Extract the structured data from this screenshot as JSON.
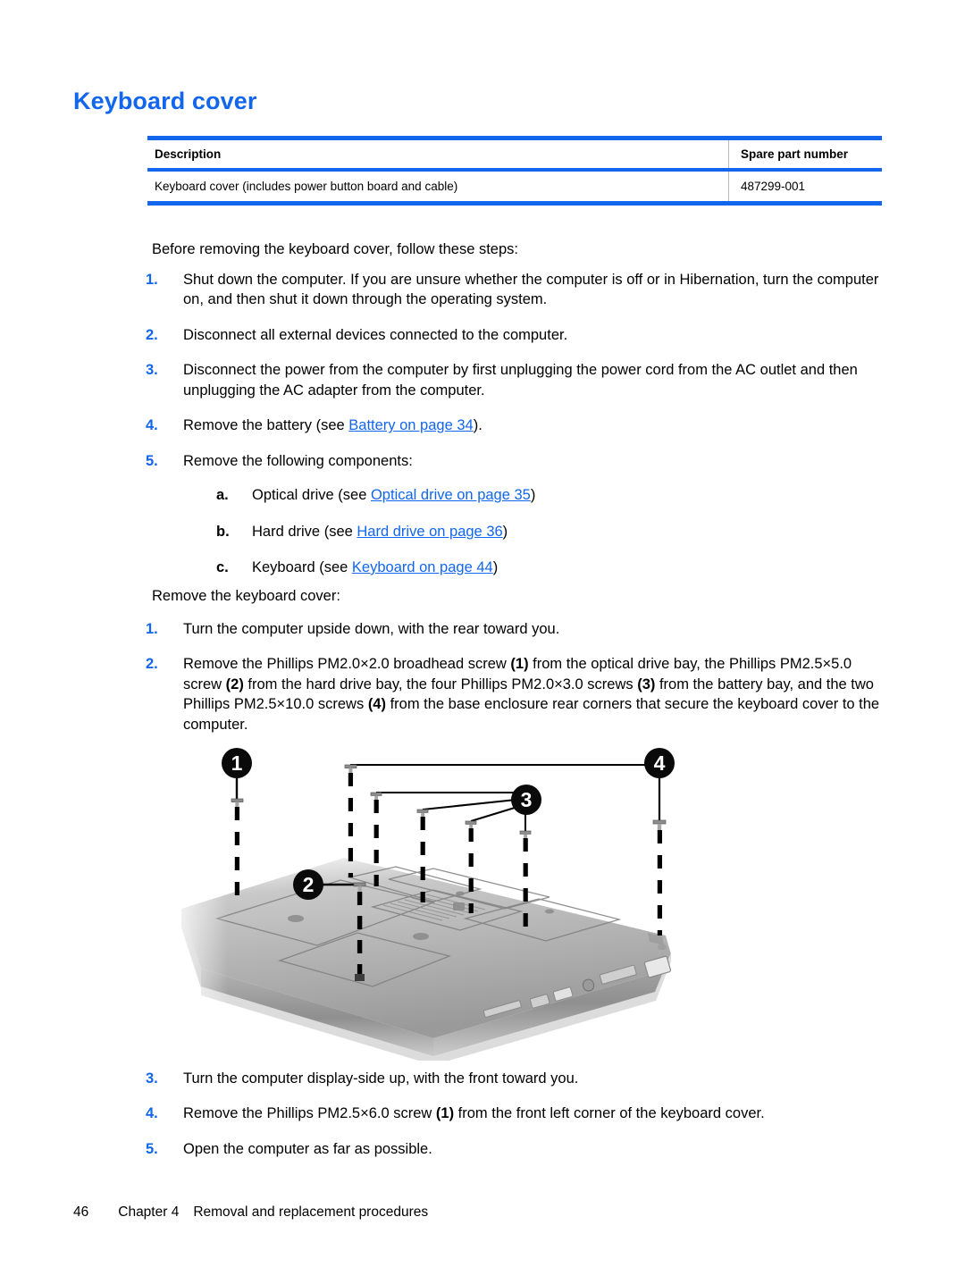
{
  "heading": "Keyboard cover",
  "spec_table": {
    "columns": [
      "Description",
      "Spare part number"
    ],
    "rows": [
      {
        "description": "Keyboard cover (includes power button board and cable)",
        "spare_part_number": "487299-001"
      }
    ]
  },
  "intro_before": "Before removing the keyboard cover, follow these steps:",
  "before_steps": [
    {
      "marker": "1.",
      "text": "Shut down the computer. If you are unsure whether the computer is off or in Hibernation, turn the computer on, and then shut it down through the operating system."
    },
    {
      "marker": "2.",
      "text": "Disconnect all external devices connected to the computer."
    },
    {
      "marker": "3.",
      "text": "Disconnect the power from the computer by first unplugging the power cord from the AC outlet and then unplugging the AC adapter from the computer."
    },
    {
      "marker": "4.",
      "text_pre": "Remove the battery (see ",
      "link": "Battery on page 34",
      "text_post": ")."
    },
    {
      "marker": "5.",
      "text": "Remove the following components:",
      "substeps": [
        {
          "marker": "a.",
          "text_pre": "Optical drive (see ",
          "link": "Optical drive on page 35",
          "text_post": ")"
        },
        {
          "marker": "b.",
          "text_pre": "Hard drive (see ",
          "link": "Hard drive on page 36",
          "text_post": ")"
        },
        {
          "marker": "c.",
          "text_pre": "Keyboard (see ",
          "link": "Keyboard on page 44",
          "text_post": ")"
        }
      ]
    }
  ],
  "intro_remove": "Remove the keyboard cover:",
  "remove_steps": [
    {
      "marker": "1.",
      "text": "Turn the computer upside down, with the rear toward you."
    },
    {
      "marker": "2.",
      "seg1": "Remove the Phillips PM2.0×2.0 broadhead screw ",
      "ref1": "(1)",
      "seg2": " from the optical drive bay, the Phillips PM2.5×5.0 screw ",
      "ref2": "(2)",
      "seg3": " from the hard drive bay, the four Phillips PM2.0×3.0 screws ",
      "ref3": "(3)",
      "seg4": " from the battery bay, and the two Phillips PM2.5×10.0 screws ",
      "ref4": "(4)",
      "seg5": " from the base enclosure rear corners that secure the keyboard cover to the computer."
    }
  ],
  "remove_steps_after": [
    {
      "marker": "3.",
      "text": "Turn the computer display-side up, with the front toward you."
    },
    {
      "marker": "4.",
      "seg1": "Remove the Phillips PM2.5×6.0 screw ",
      "ref1": "(1)",
      "seg2": " from the front left corner of the keyboard cover."
    },
    {
      "marker": "5.",
      "text": "Open the computer as far as possible."
    }
  ],
  "figure": {
    "alt": "Bottom view of notebook computer with screw callouts",
    "callouts": [
      "1",
      "2",
      "3",
      "4"
    ]
  },
  "footer": {
    "page_number": "46",
    "chapter": "Chapter 4",
    "title": "Removal and replacement procedures"
  },
  "colors": {
    "accent_blue": "#1266ee",
    "text_black": "#000000",
    "rule_blue": "#1266ee"
  }
}
